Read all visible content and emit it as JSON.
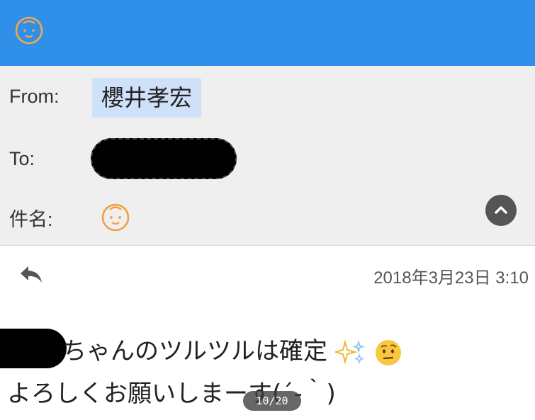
{
  "header": {
    "from_label": "From:",
    "from_value": "櫻井孝宏",
    "to_label": "To:",
    "subject_label": "件名:"
  },
  "message": {
    "timestamp": "2018年3月23日 3:10",
    "line1": "ちゃんのツルツルは確定",
    "line2": "よろしくお願いしまーす(´-｀)"
  },
  "viewer": {
    "page_indicator": "10/20"
  },
  "colors": {
    "topbar": "#2f8fe9",
    "header_bg": "#efefef",
    "chip_bg": "#cfe1f8",
    "icon_orange": "#f2a03d"
  },
  "icons": [
    "baby-face-icon",
    "baby-face-icon",
    "chevron-up-icon",
    "reply-icon",
    "sparkles-icon",
    "face-emoji-icon"
  ]
}
